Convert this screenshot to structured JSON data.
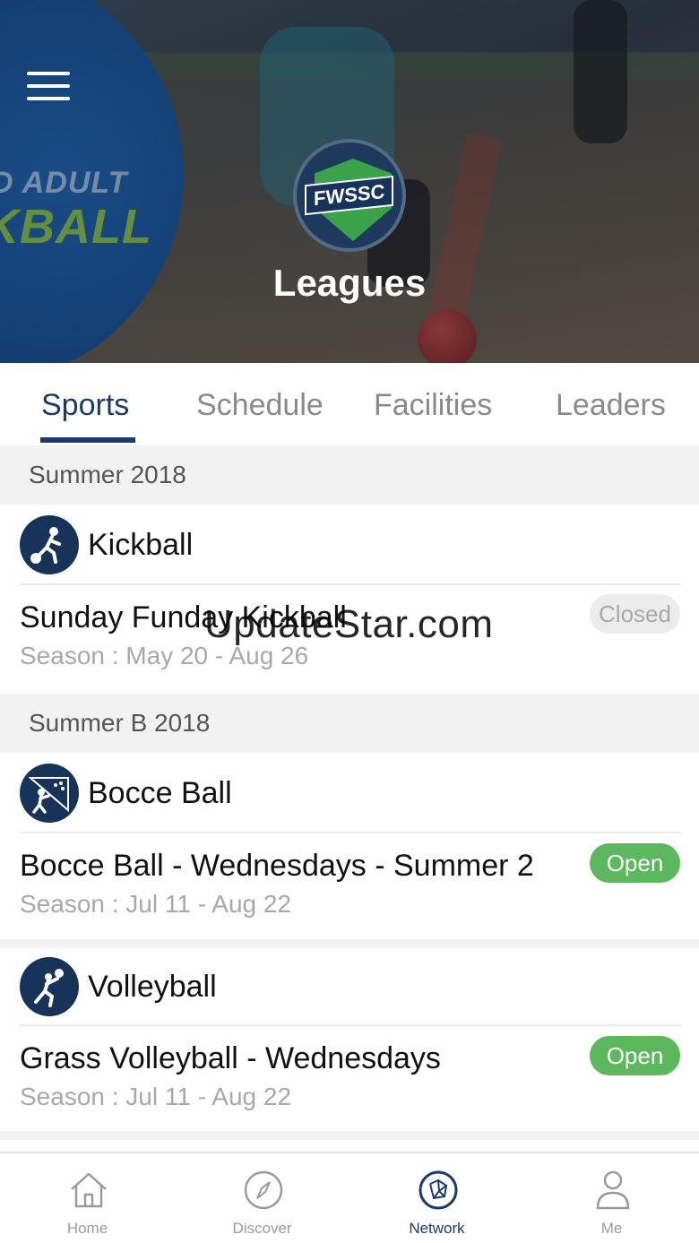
{
  "hero": {
    "title": "Leagues",
    "logo_text": "FWSSC",
    "background_text_line1": "D ADULT",
    "background_text_line2": "KBALL"
  },
  "tabs": [
    {
      "label": "Sports",
      "active": true
    },
    {
      "label": "Schedule",
      "active": false
    },
    {
      "label": "Facilities",
      "active": false
    },
    {
      "label": "Leaders",
      "active": false
    }
  ],
  "sections": [
    {
      "header": "Summer 2018",
      "sports": [
        {
          "name": "Kickball",
          "icon": "kickball-icon",
          "leagues": [
            {
              "name": "Sunday Funday Kickball",
              "season": "Season : May 20 - Aug 26",
              "status": "Closed"
            }
          ]
        }
      ]
    },
    {
      "header": "Summer B 2018",
      "sports": [
        {
          "name": "Bocce Ball",
          "icon": "bocce-ball-icon",
          "leagues": [
            {
              "name": "Bocce Ball - Wednesdays - Summer 2",
              "season": "Season : Jul 11 - Aug 22",
              "status": "Open"
            }
          ]
        },
        {
          "name": "Volleyball",
          "icon": "volleyball-icon",
          "leagues": [
            {
              "name": "Grass Volleyball - Wednesdays",
              "season": "Season : Jul 11 - Aug 22",
              "status": "Open"
            }
          ]
        }
      ]
    }
  ],
  "watermark": "UpdateStar.com",
  "bottom_nav": [
    {
      "label": "Home",
      "icon": "home-icon",
      "active": false
    },
    {
      "label": "Discover",
      "icon": "compass-icon",
      "active": false
    },
    {
      "label": "Network",
      "icon": "network-icon",
      "active": true
    },
    {
      "label": "Me",
      "icon": "person-icon",
      "active": false
    }
  ],
  "colors": {
    "primary": "#1b3a6b",
    "open_badge": "#5cb85c",
    "closed_badge": "#ececec",
    "section_bg": "#f2f2f2"
  }
}
